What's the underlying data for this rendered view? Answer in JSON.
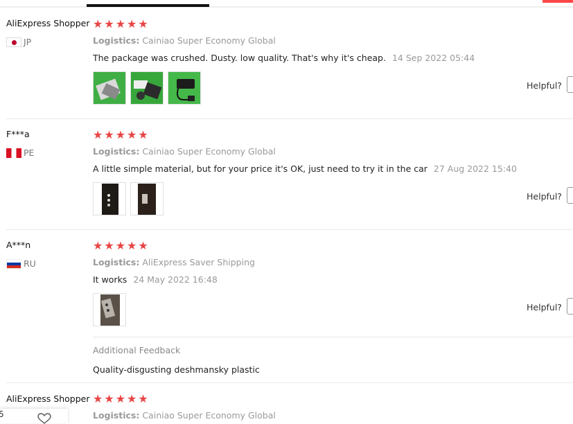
{
  "helpful_label": "Helpful?",
  "logistics_label": "Logistics:",
  "additional_feedback_label": "Additional Feedback",
  "colors": {
    "star": "#e84545",
    "accent_red": "#ff4747"
  },
  "reviews": [
    {
      "user": "AliExpress Shopper",
      "country": "JP",
      "flag": "flag-jp",
      "rating": "★★★★★",
      "logistics": "Cainiao Super Economy Global",
      "text": "The package was crushed. Dusty. low quality. That's why it's cheap.",
      "date": "14 Sep 2022 05:44"
    },
    {
      "user": "F***a",
      "country": "PE",
      "flag": "flag-pe",
      "rating": "★★★★★",
      "logistics": "Cainiao Super Economy Global",
      "text": "A little simple material, but for your price it's OK, just need to try it in the car",
      "date": "27 Aug 2022 15:40"
    },
    {
      "user": "A***n",
      "country": "RU",
      "flag": "flag-ru",
      "rating": "★★★★★",
      "logistics": "AliExpress Saver Shipping",
      "text": "It works",
      "date": "24 May 2022 16:48",
      "additional_feedback": "Quality-disgusting deshmansky plastic"
    },
    {
      "user": "AliExpress Shopper",
      "rating": "★★★★★",
      "logistics": "Cainiao Super Economy Global"
    }
  ],
  "float_widget": {
    "count": "5"
  }
}
